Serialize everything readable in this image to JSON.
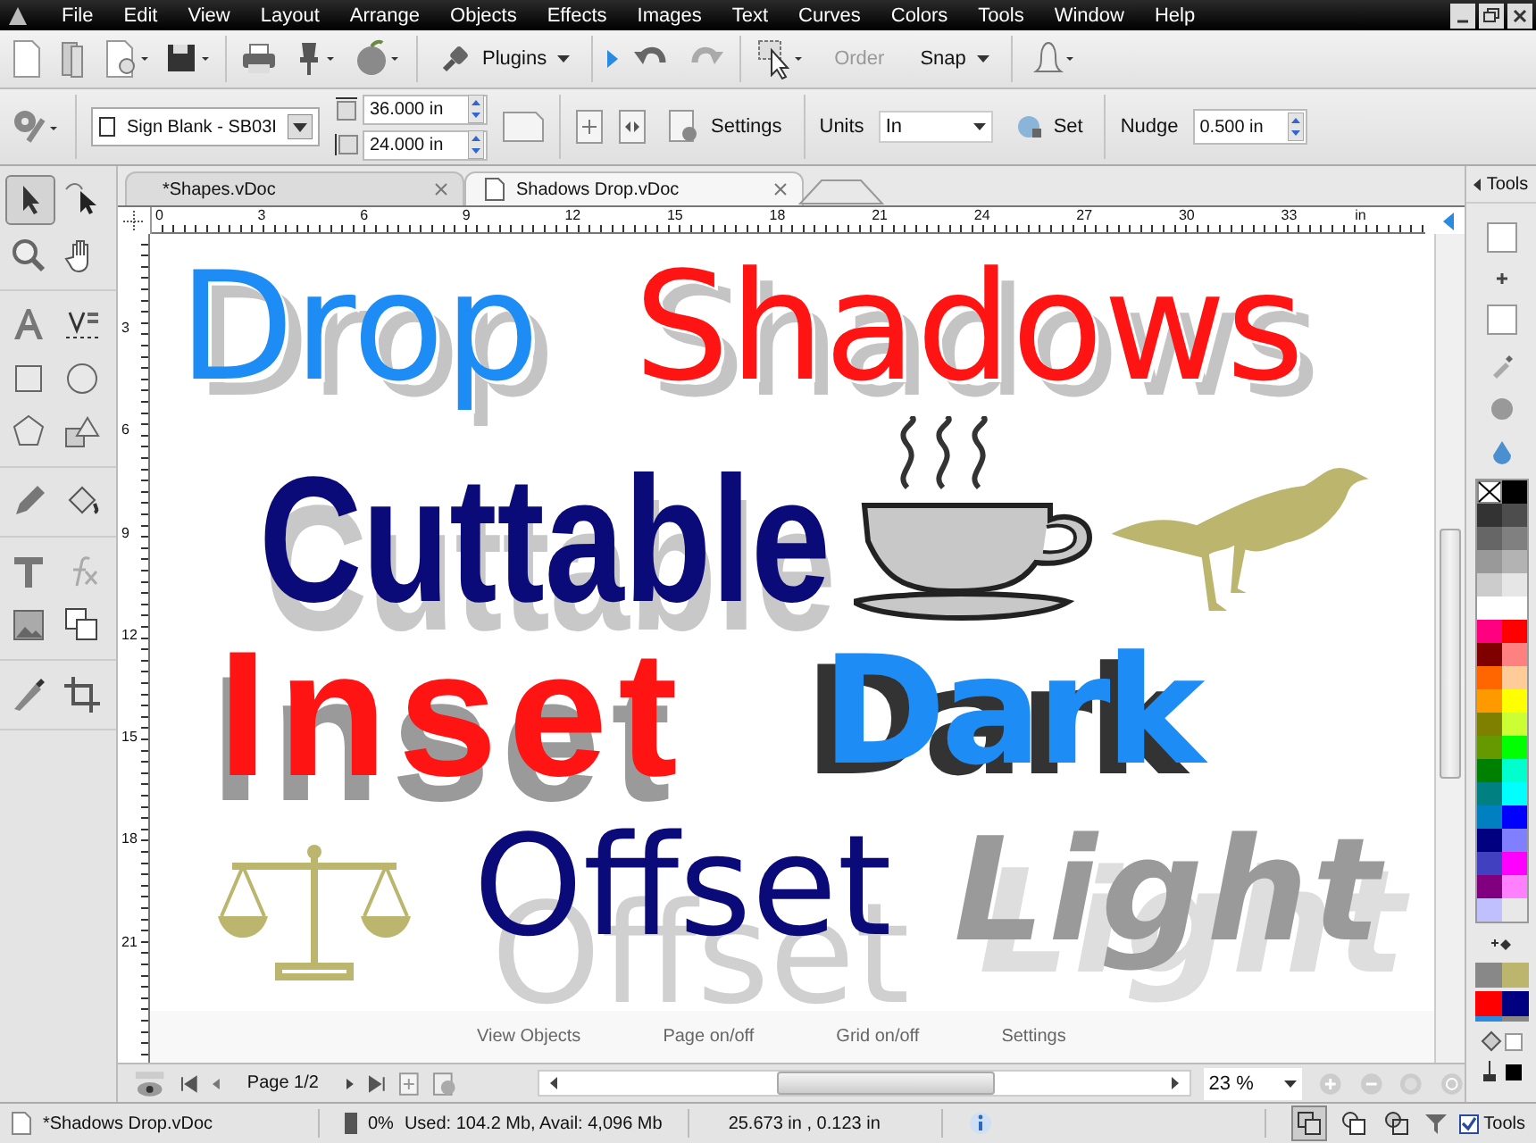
{
  "menu": [
    "File",
    "Edit",
    "View",
    "Layout",
    "Arrange",
    "Objects",
    "Effects",
    "Images",
    "Text",
    "Curves",
    "Colors",
    "Tools",
    "Window",
    "Help"
  ],
  "toolbar": {
    "plugins": "Plugins",
    "order": {
      "label": "Order",
      "disabled": true
    },
    "snap": "Snap"
  },
  "page_bar": {
    "template": "Sign Blank - SB03I",
    "width": "36.000 in",
    "height": "24.000 in",
    "settings": "Settings",
    "units_label": "Units",
    "units": "In",
    "set": "Set",
    "nudge_label": "Nudge",
    "nudge": "0.500 in"
  },
  "tabs": [
    {
      "label": "*Shapes.vDoc",
      "selected": false
    },
    {
      "label": "Shadows Drop.vDoc",
      "selected": true
    }
  ],
  "ruler": {
    "h": [
      "0",
      "3",
      "6",
      "9",
      "12",
      "15",
      "18",
      "21",
      "24",
      "27",
      "30",
      "33"
    ],
    "unit": "in",
    "v": [
      "3",
      "6",
      "9",
      "12",
      "15",
      "18",
      "21"
    ]
  },
  "canvas": {
    "items": [
      {
        "kind": "drop",
        "text": "Drop",
        "color": "#1e8cf5"
      },
      {
        "kind": "drop",
        "text": "Shadows",
        "color": "#ff1414"
      },
      {
        "kind": "cuttable",
        "text": "Cuttable",
        "color": "#0a0a78"
      },
      {
        "kind": "inset",
        "text": "Inset",
        "color": "#ff1414"
      },
      {
        "kind": "dark",
        "text": "Dark",
        "color": "#1e8cf5"
      },
      {
        "kind": "offset",
        "text": "Offset",
        "color": "#0a0a78"
      },
      {
        "kind": "light",
        "text": "Light",
        "color": "#9a9a9a"
      }
    ]
  },
  "canvas_actions": [
    "View Objects",
    "Page on/off",
    "Grid on/off",
    "Settings"
  ],
  "nav": {
    "page": "Page 1/2",
    "zoom": "23 %"
  },
  "tools_panel": {
    "title": "Tools",
    "palette": [
      {
        "color": "#000000"
      },
      {
        "color": "#333333"
      },
      {
        "color": "#4d4d4d"
      },
      {
        "color": "#666666"
      },
      {
        "color": "#808080"
      },
      {
        "color": "#999999"
      },
      {
        "color": "#b3b3b3"
      },
      {
        "color": "#cccccc"
      },
      {
        "color": "#e6e6e6"
      },
      {
        "color": "#ffffff"
      },
      {
        "color": "#ffffff"
      },
      {
        "color": "#ff0080"
      },
      {
        "color": "#ff0000"
      },
      {
        "color": "#800000"
      },
      {
        "color": "#ff8080"
      },
      {
        "color": "#ff6600"
      },
      {
        "color": "#ffcc99"
      },
      {
        "color": "#ff9900"
      },
      {
        "color": "#ffff00"
      },
      {
        "color": "#808000"
      },
      {
        "color": "#ccff33"
      },
      {
        "color": "#669900"
      },
      {
        "color": "#00ff00"
      },
      {
        "color": "#008000"
      },
      {
        "color": "#00ffcc"
      },
      {
        "color": "#008080"
      },
      {
        "color": "#00ffff"
      },
      {
        "color": "#0080c0"
      },
      {
        "color": "#0000ff"
      },
      {
        "color": "#000080"
      },
      {
        "color": "#8080ff"
      },
      {
        "color": "#4040c0"
      },
      {
        "color": "#ff00ff"
      },
      {
        "color": "#800080"
      },
      {
        "color": "#ff80ff"
      },
      {
        "color": "#c0c0ff"
      }
    ]
  },
  "status": {
    "file": "*Shadows Drop.vDoc",
    "memory_pct": "0%",
    "memory": "Used: 104.2 Mb, Avail: 4,096 Mb",
    "position": "25.673 in , 0.123 in",
    "tools": {
      "label": "Tools",
      "checked": true
    }
  }
}
